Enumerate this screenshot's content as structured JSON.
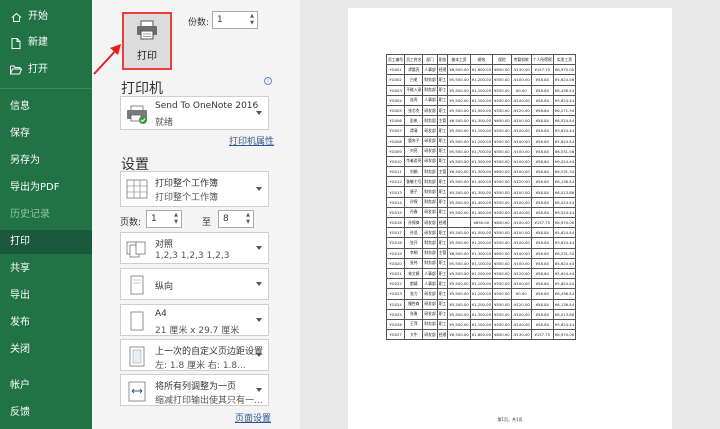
{
  "sidebar": {
    "items": [
      {
        "label": "开始",
        "icon": "home-icon"
      },
      {
        "label": "新建",
        "icon": "new-document-icon"
      },
      {
        "label": "打开",
        "icon": "folder-open-icon"
      },
      {
        "label": "信息"
      },
      {
        "label": "保存"
      },
      {
        "label": "另存为"
      },
      {
        "label": "导出为PDF"
      },
      {
        "label": "历史记录"
      },
      {
        "label": "打印"
      },
      {
        "label": "共享"
      },
      {
        "label": "导出"
      },
      {
        "label": "发布"
      },
      {
        "label": "关闭"
      },
      {
        "label": "帐户"
      },
      {
        "label": "反馈"
      }
    ]
  },
  "print": {
    "button_label": "打印",
    "copies_label": "份数:",
    "copies_value": "1"
  },
  "printer": {
    "heading": "打印机",
    "name": "Send To OneNote 2016",
    "status": "就绪",
    "properties_link": "打印机属性"
  },
  "settings": {
    "heading": "设置",
    "what": {
      "line1": "打印整个工作簿",
      "line2": "打印整个工作簿"
    },
    "pages_label": "页数:",
    "pages_from": "1",
    "pages_to_label": "至",
    "pages_to": "8",
    "collate": {
      "line1": "对照",
      "line2": "1,2,3    1,2,3    1,2,3"
    },
    "orientation": {
      "line1": "纵向"
    },
    "paper": {
      "line1": "A4",
      "line2": "21 厘米 x 29.7 厘米"
    },
    "margins": {
      "line1": "上一次的自定义页边距设置",
      "line2": "左: 1.8 厘米    右: 1.8..."
    },
    "scaling": {
      "line1": "将所有列调整为一页",
      "line2": "缩减打印输出使其只有一..."
    },
    "page_setup_link": "页面设置"
  },
  "preview": {
    "headers": [
      "员工编号",
      "员工姓名",
      "部门",
      "职务",
      "基本工资",
      "绩效",
      "保险",
      "考勤扣款",
      "个人所得税",
      "实发工资"
    ],
    "rows": [
      [
        "YG001",
        "谭晨亮",
        "人事部",
        "经理",
        "¥8,500.00",
        "¥1,800.00",
        "¥850.00",
        "-¥130.00",
        "¥157.75",
        "¥8,970.00"
      ],
      [
        "YG002",
        "白老",
        "财务部",
        "职工",
        "¥5,500.00",
        "¥1,200.00",
        "¥550.00",
        "-¥100.00",
        "¥58.84",
        "¥5,624.56"
      ],
      [
        "YG003",
        "不能入录",
        "财务部",
        "职工",
        "¥5,500.00",
        "¥1,100.00",
        "¥550.00",
        "¥0.00",
        "¥58.84",
        "¥6,436.44"
      ],
      [
        "YG004",
        "连亮",
        "人事部",
        "职工",
        "¥5,500.00",
        "¥1,100.00",
        "¥550.00",
        "-¥100.00",
        "¥58.84",
        "¥5,624.44"
      ],
      [
        "YG005",
        "张芯杰",
        "研发部",
        "职工",
        "¥5,500.00",
        "¥1,500.00",
        "¥550.00",
        "-¥120.00",
        "¥58.84",
        "¥6,271.34"
      ],
      [
        "YG006",
        "彭来",
        "财务部",
        "主管",
        "¥6,500.00",
        "¥1,300.00",
        "¥650.00",
        "-¥100.00",
        "¥58.84",
        "¥6,524.44"
      ],
      [
        "YG007",
        "谭清",
        "研发部",
        "职工",
        "¥5,500.00",
        "¥1,100.00",
        "¥550.00",
        "-¥100.00",
        "¥58.84",
        "¥5,624.44"
      ],
      [
        "YG008",
        "鹿奔子",
        "研发部",
        "职工",
        "¥5,500.00",
        "¥1,200.00",
        "¥550.00",
        "-¥100.00",
        "¥58.84",
        "¥5,624.44"
      ],
      [
        "YG009",
        "刘亮",
        "研发部",
        "职工",
        "¥5,500.00",
        "¥1,700.00",
        "¥550.00",
        "-¥100.00",
        "¥58.84",
        "¥6,531.56"
      ],
      [
        "YG010",
        "华者君亮",
        "研发部",
        "职工",
        "¥5,500.00",
        "¥1,300.00",
        "¥550.00",
        "-¥100.00",
        "¥58.84",
        "¥6,024.44"
      ],
      [
        "YG011",
        "刘娟",
        "财务部",
        "主管",
        "¥6,500.00",
        "¥1,300.00",
        "¥650.00",
        "-¥100.00",
        "¥58.84",
        "¥6,531.34"
      ],
      [
        "YG012",
        "鲁敏七号",
        "财务部",
        "职工",
        "¥5,500.00",
        "¥1,400.00",
        "¥550.00",
        "-¥120.00",
        "¥58.84",
        "¥6,136.44"
      ],
      [
        "YG013",
        "唐子",
        "财务部",
        "职工",
        "¥5,500.00",
        "¥1,300.00",
        "¥550.00",
        "-¥100.00",
        "¥58.84",
        "¥6,013.86"
      ],
      [
        "YG014",
        "孙保",
        "财务部",
        "职工",
        "¥5,500.00",
        "¥1,400.00",
        "¥550.00",
        "-¥100.00",
        "¥58.84",
        "¥6,024.44"
      ],
      [
        "YG015",
        "孙春",
        "研发部",
        "职工",
        "¥5,500.00",
        "¥1,400.00",
        "¥550.00",
        "-¥100.00",
        "¥58.84",
        "¥6,524.44"
      ],
      [
        "YG016",
        "孙保律",
        "研发部",
        "经理",
        "",
        "¥850.00",
        "¥850.00",
        "-¥100.00",
        "¥157.75",
        "¥8,970.00"
      ],
      [
        "YG017",
        "孙浩",
        "研发部",
        "职工",
        "¥5,500.00",
        "¥1,500.00",
        "¥550.00",
        "-¥100.00",
        "¥58.84",
        "¥5,624.44"
      ],
      [
        "YG018",
        "张开",
        "财务部",
        "职工",
        "¥5,500.00",
        "¥1,200.00",
        "¥550.00",
        "-¥100.00",
        "¥58.84",
        "¥5,624.44"
      ],
      [
        "YG019",
        "李桐",
        "财务部",
        "主管",
        "¥6,500.00",
        "¥1,300.00",
        "¥650.00",
        "-¥100.00",
        "¥58.84",
        "¥6,531.34"
      ],
      [
        "YG020",
        "张伟",
        "财务部",
        "职工",
        "¥5,500.00",
        "¥1,100.00",
        "¥550.00",
        "-¥100.00",
        "¥58.84",
        "¥5,624.44"
      ],
      [
        "YG021",
        "林文娟",
        "人事部",
        "职工",
        "¥5,500.00",
        "¥1,200.00",
        "¥550.00",
        "-¥120.00",
        "¥58.84",
        "¥5,624.44"
      ],
      [
        "YG022",
        "都婧",
        "人事部",
        "职工",
        "¥5,500.00",
        "¥1,100.00",
        "¥550.00",
        "-¥100.00",
        "¥58.84",
        "¥5,624.44"
      ],
      [
        "YG023",
        "张力",
        "研发部",
        "职工",
        "¥5,500.00",
        "¥1,200.00",
        "¥550.00",
        "¥0.00",
        "¥58.84",
        "¥6,436.44"
      ],
      [
        "YG024",
        "慢性森",
        "研发部",
        "职工",
        "¥5,500.00",
        "¥1,200.00",
        "¥550.00",
        "-¥120.00",
        "¥58.84",
        "¥6,136.44"
      ],
      [
        "YG025",
        "张勇",
        "研发部",
        "职工",
        "¥5,500.00",
        "¥1,300.00",
        "¥550.00",
        "-¥100.00",
        "¥58.84",
        "¥6,013.86"
      ],
      [
        "YG026",
        "王萍",
        "财务部",
        "职工",
        "¥5,500.00",
        "¥1,100.00",
        "¥550.00",
        "-¥100.00",
        "¥58.84",
        "¥5,624.44"
      ],
      [
        "YG027",
        "大牛",
        "研发部",
        "经理",
        "¥8,500.00",
        "¥1,800.00",
        "¥850.00",
        "-¥130.00",
        "¥157.75",
        "¥8,970.00"
      ]
    ],
    "footer": "第1页，共1页"
  }
}
